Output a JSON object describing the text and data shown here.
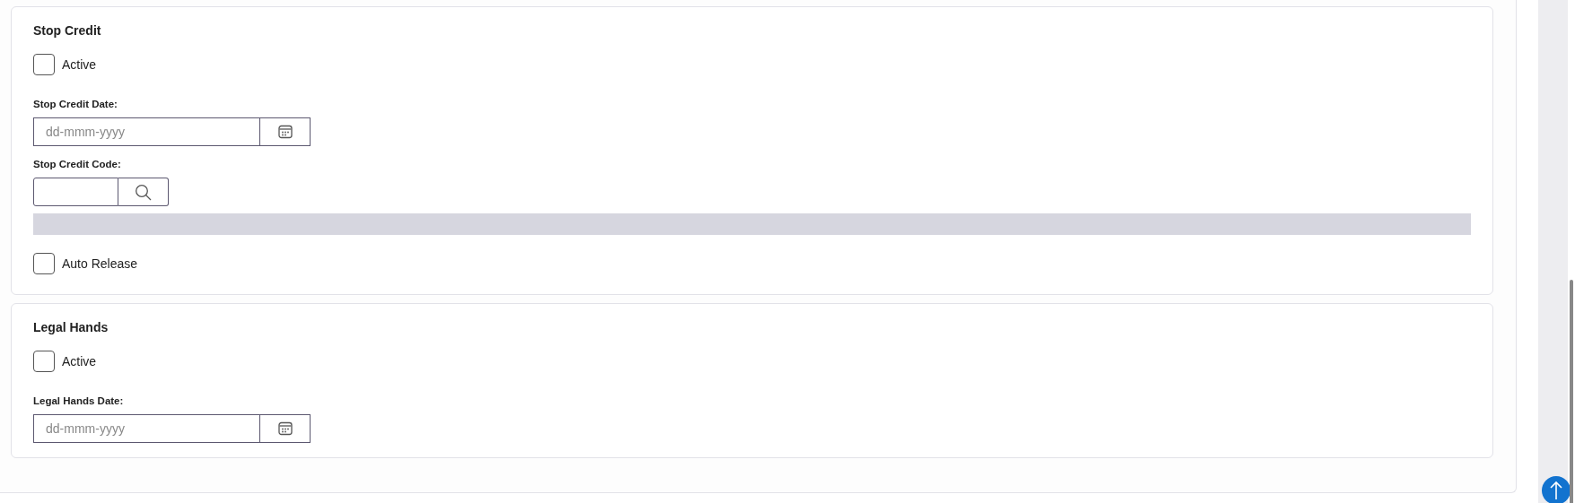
{
  "sections": [
    {
      "title": "Stop Credit",
      "fields": [
        {
          "kind": "checkbox",
          "label": "Active",
          "checked": false
        },
        {
          "kind": "date",
          "label": "Stop Credit Date:",
          "placeholder": "dd-mmm-yyyy"
        },
        {
          "kind": "lookup",
          "label": "Stop Credit Code:"
        },
        {
          "kind": "bar"
        },
        {
          "kind": "checkbox",
          "label": "Auto Release",
          "checked": false
        }
      ]
    },
    {
      "title": "Legal Hands",
      "fields": [
        {
          "kind": "checkbox",
          "label": "Active",
          "checked": false
        },
        {
          "kind": "date",
          "label": "Legal Hands Date:",
          "placeholder": "dd-mmm-yyyy"
        }
      ]
    }
  ]
}
